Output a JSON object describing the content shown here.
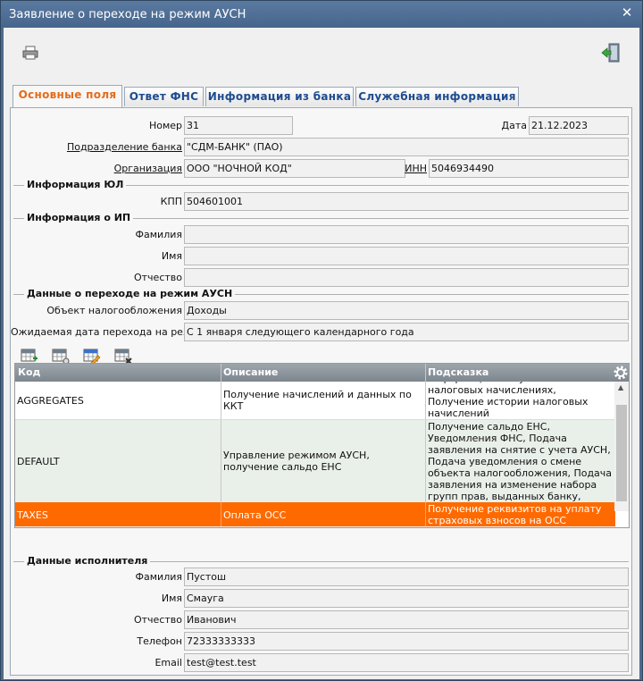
{
  "window": {
    "title": "Заявление о переходе на режим АУСН"
  },
  "tabs": [
    {
      "label": "Основные поля"
    },
    {
      "label": "Ответ ФНС"
    },
    {
      "label": "Информация из банка"
    },
    {
      "label": "Служебная информация"
    }
  ],
  "main": {
    "number_label": "Номер",
    "number_value": "31",
    "date_label": "Дата",
    "date_value": "21.12.2023",
    "bank_division_label": "Подразделение банка",
    "bank_division_value": "\"СДМ-БАНК\" (ПАО)",
    "org_label": "Организация",
    "org_value": "ООО \"НОЧНОЙ КОД\"",
    "inn_label": "ИНН",
    "inn_value": "5046934490"
  },
  "ul_section": {
    "title": "Информация ЮЛ",
    "kpp_label": "КПП",
    "kpp_value": "504601001"
  },
  "ip_section": {
    "title": "Информация о ИП",
    "surname_label": "Фамилия",
    "surname_value": "",
    "name_label": "Имя",
    "name_value": "",
    "patronymic_label": "Отчество",
    "patronymic_value": ""
  },
  "transition_section": {
    "title": "Данные о переходе на режим АУСН",
    "object_label": "Объект налогообложения",
    "object_value": "Доходы",
    "date_label": "Ожидаемая дата перехода на режим",
    "date_value": "С 1 января следующего календарного года"
  },
  "grid": {
    "columns": [
      "Код",
      "Описание",
      "Подсказка"
    ],
    "rows": [
      {
        "code": "AGGREGATES",
        "desc": "Получение начислений и данных по ККТ",
        "hint": "информации о неуплаченных налоговых начислениях, Получение истории налоговых начислений"
      },
      {
        "code": "DEFAULT",
        "desc": "Управление режимом АУСН, получение сальдо ЕНС",
        "hint": "Получение сальдо ЕНС, Уведомления ФНС, Подача заявления на снятие с учета АУСН, Подача уведомления о смене объекта налогообложения, Подача заявления на изменение набора групп прав, выданных банку, Подача заявления на обновление контактных данных"
      },
      {
        "code": "TAXES",
        "desc": "Оплата ОСС",
        "hint": "Получение реквизитов на уплату страховых взносов на ОСС"
      }
    ]
  },
  "executor_section": {
    "title": "Данные исполнителя",
    "surname_label": "Фамилия",
    "surname_value": "Пустош",
    "name_label": "Имя",
    "name_value": "Смауга",
    "patronymic_label": "Отчество",
    "patronymic_value": "Иванович",
    "phone_label": "Телефон",
    "phone_value": "72333333333",
    "email_label": "Email",
    "email_value": "test@test.test"
  },
  "colors": {
    "accent": "#ff6a00",
    "tab_active": "#e46b1b",
    "tab_text": "#1d4b8f"
  }
}
